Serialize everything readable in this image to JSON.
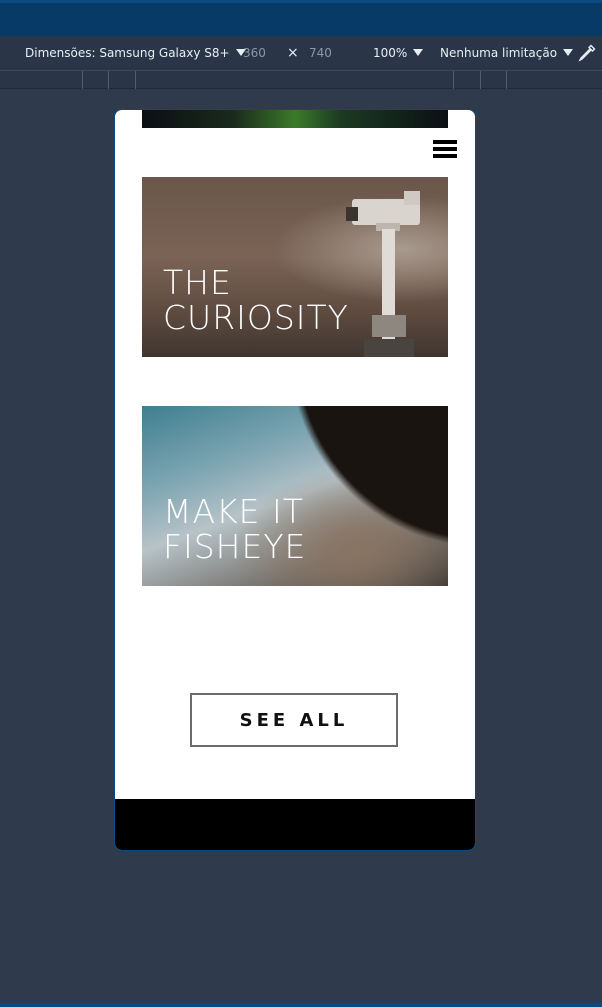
{
  "devtools": {
    "dimensions_label": "Dimensões: Samsung Galaxy S8+",
    "width_value": "360",
    "times_symbol": "×",
    "height_value": "740",
    "zoom_label": "100%",
    "throttle_label": "Nenhuma limitação",
    "eyedropper_icon": "eyedropper-icon"
  },
  "site": {
    "menu_icon": "hamburger-menu-icon",
    "cards": [
      {
        "title_line1": "THE",
        "title_line2": "CURIOSITY"
      },
      {
        "title_line1": "MAKE IT",
        "title_line2": "FISHEYE"
      }
    ],
    "see_all_label": "SEE ALL"
  },
  "colors": {
    "page_background": "#2f3b4c",
    "toolbar_background": "#2a3647",
    "browser_strip": "#073a66",
    "device_border": "#0a4a80",
    "footer": "#000000"
  }
}
